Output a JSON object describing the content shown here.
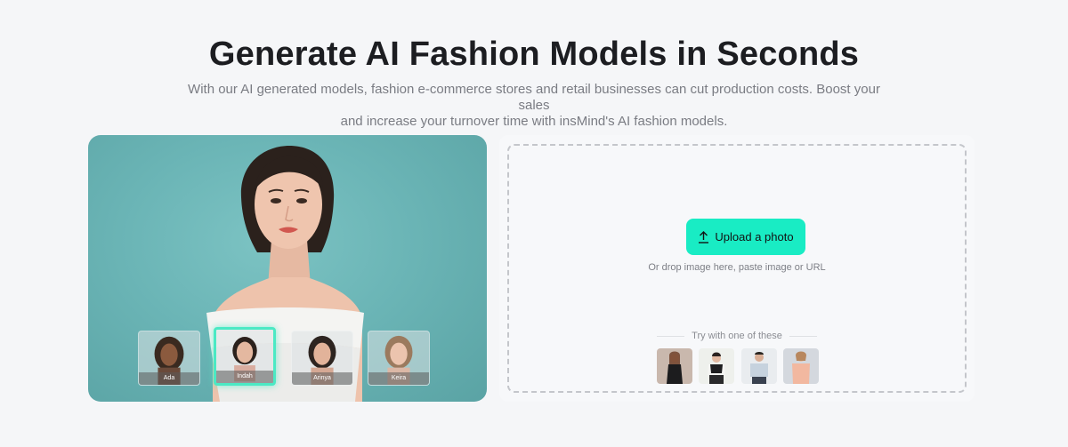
{
  "hero": {
    "title": "Generate AI Fashion Models in Seconds",
    "subtitle_line1": "With our AI generated models, fashion e-commerce stores and retail businesses can cut production costs. Boost your sales",
    "subtitle_line2": "and increase your turnover time with insMind's AI fashion models."
  },
  "showcase": {
    "models": [
      {
        "name": "Ada",
        "selected": false
      },
      {
        "name": "Indah",
        "selected": true
      },
      {
        "name": "Arinya",
        "selected": false
      },
      {
        "name": "Keira",
        "selected": false
      }
    ],
    "accent": "#4be9c4",
    "background": "#6bb5b6"
  },
  "upload": {
    "button_label": "Upload a photo",
    "button_icon": "upload-arrow-icon",
    "button_color": "#19ecc4",
    "drop_hint": "Or drop image here, paste image or URL",
    "try_label": "Try with one of these",
    "samples": [
      "sample-woman-black-dress",
      "sample-woman-black-white-top",
      "sample-man-light-shirt",
      "sample-woman-pink-shirt"
    ]
  }
}
